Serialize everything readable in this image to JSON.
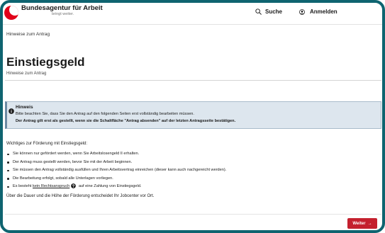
{
  "header": {
    "brand_name": "Bundesagentur für Arbeit",
    "brand_tagline": "bringt weiter.",
    "search_label": "Suche",
    "login_label": "Anmelden"
  },
  "breadcrumb": "Hinweise zum Antrag",
  "page": {
    "title": "Einstiegsgeld",
    "subtitle": "Hinweise zum Antrag"
  },
  "notice": {
    "heading": "Hinweis",
    "line1": "Bitte beachten Sie, dass Sie den Antrag auf den folgenden Seiten erst vollständig bearbeiten müssen.",
    "line2": "Der Antrag gilt erst als gestellt, wenn sie die Schaltfläche \"Antrag absenden\" auf der letzten Antragsseite bestätigen."
  },
  "content": {
    "intro": "Wichtiges zur Förderung mit Einstiegsgeld:",
    "bullets": [
      "Sie können nur gefördert werden, wenn Sie Arbeitslosengeld II erhalten.",
      "Der Antrag muss gestellt werden, bevor Sie mit der Arbeit beginnen.",
      "Sie müssen den Antrag vollständig ausfüllen und Ihren Arbeitsvertrag einreichen (dieser kann auch nachgereicht werden).",
      "Die Bearbeitung erfolgt, sobald alle Unterlagen vorliegen."
    ],
    "last_bullet_prefix": "Es besteht",
    "last_bullet_link": "kein Rechtsanspruch",
    "last_bullet_suffix": "auf eine Zahlung von Einstiegsgeld.",
    "outro": "Über die Dauer und die Höhe der Förderung entscheidet Ihr Jobcenter vor Ort."
  },
  "footer": {
    "next_label": "Weiter",
    "next_arrow": "→"
  },
  "colors": {
    "frame_border": "#0f6470",
    "brand_red": "#e2001a",
    "button_red": "#c4202e",
    "notice_bg": "#dde6ee"
  },
  "icons": {
    "search": "search-icon",
    "login": "user-icon",
    "notice": "info-icon",
    "help": "help-icon",
    "arrow": "arrow-right-icon"
  }
}
